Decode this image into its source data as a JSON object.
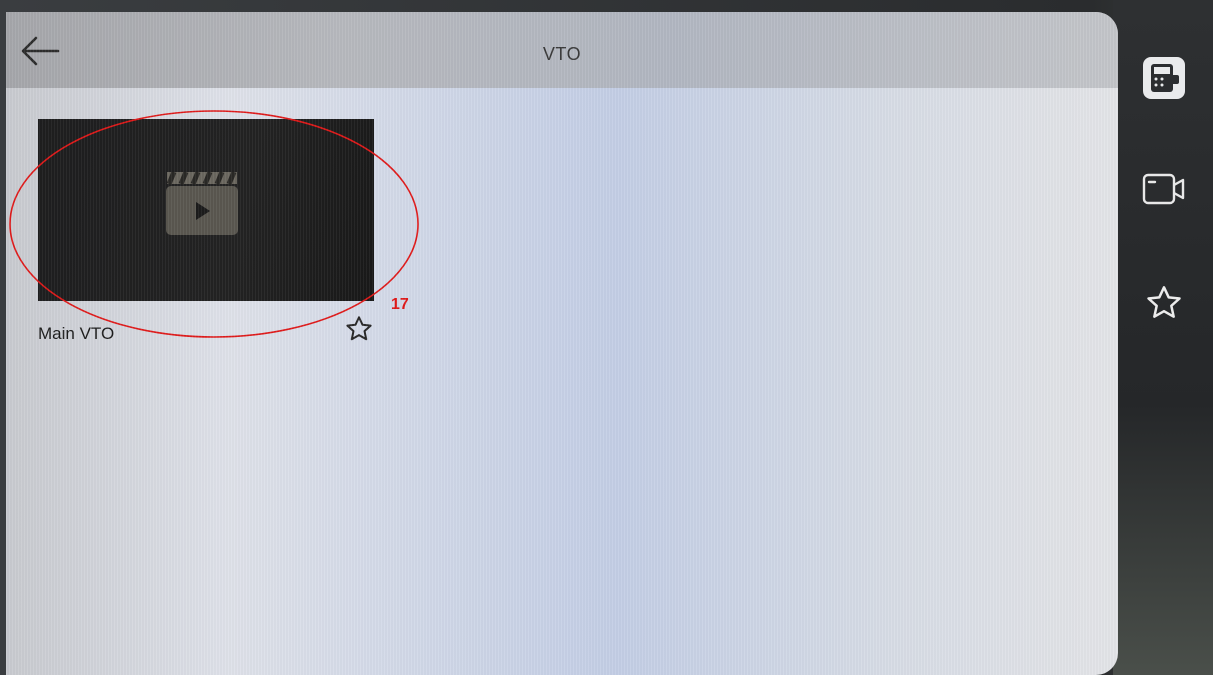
{
  "header": {
    "title": "VTO",
    "back_icon": "back-arrow-icon"
  },
  "devices": [
    {
      "label": "Main VTO",
      "thumbnail_icon": "video-clapper-icon",
      "favorite_icon": "star-outline-icon",
      "favorited": false
    }
  ],
  "annotation": {
    "label": "17",
    "color": "#e01a1a"
  },
  "side_nav": [
    {
      "icon": "intercom-icon",
      "active": true
    },
    {
      "icon": "camera-icon",
      "active": false
    },
    {
      "icon": "star-outline-icon",
      "active": false
    }
  ]
}
